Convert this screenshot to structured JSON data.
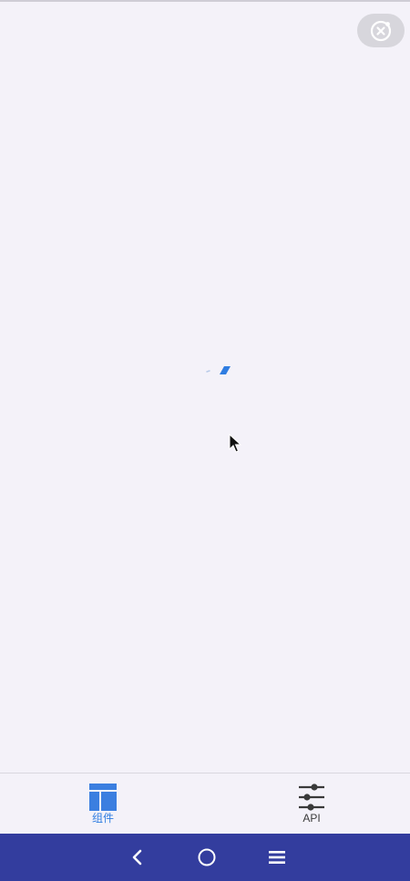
{
  "header": {
    "close_icon": "close-circle-icon"
  },
  "content": {
    "loading_icon": "loading-spinner-icon"
  },
  "tabbar": {
    "tabs": [
      {
        "label": "组件",
        "icon": "layout-grid-icon",
        "active": true
      },
      {
        "label": "API",
        "icon": "sliders-icon",
        "active": false
      }
    ]
  },
  "system_nav": {
    "back_icon": "back-chevron-icon",
    "home_icon": "home-circle-icon",
    "menu_icon": "menu-lines-icon"
  },
  "colors": {
    "background": "#f4f2f9",
    "accent": "#2f7de1",
    "tab_icon_active": "#3b7fe0",
    "nav_bar": "#333d9e",
    "capsule": "#d7d6dc"
  }
}
